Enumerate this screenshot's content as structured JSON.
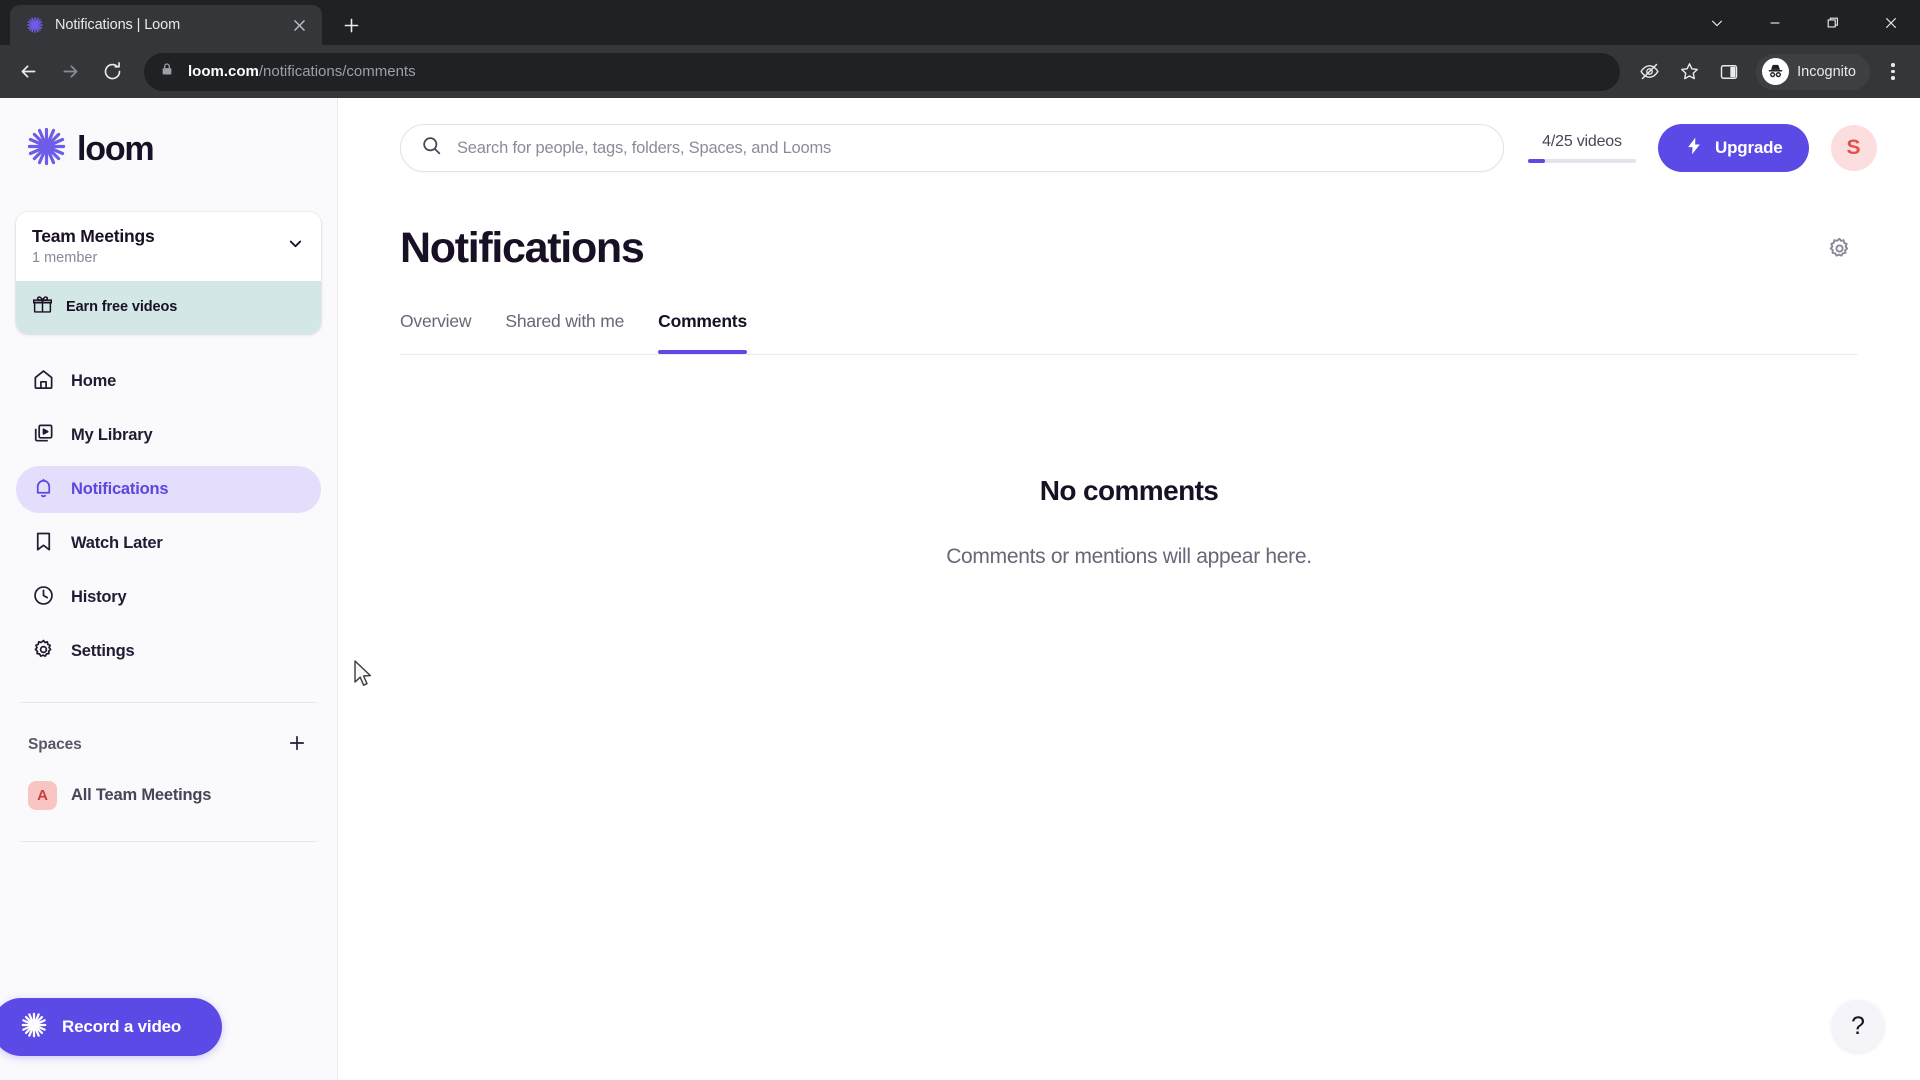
{
  "browser": {
    "tab": {
      "title": "Notifications | Loom",
      "favicon_icon": "loom-logo-icon",
      "close_icon": "close-icon"
    },
    "newtab_icon": "plus-icon",
    "window_controls": [
      {
        "name": "chevron-down-icon",
        "glyph": "chevron-down"
      },
      {
        "name": "minimize-icon",
        "glyph": "minimize"
      },
      {
        "name": "maximize-icon",
        "glyph": "maximize"
      },
      {
        "name": "close-window-icon",
        "glyph": "close"
      }
    ],
    "nav": {
      "back_icon": "back-arrow-icon",
      "forward_icon": "forward-arrow-icon",
      "reload_icon": "reload-icon"
    },
    "omnibox": {
      "lock_icon": "lock-icon",
      "host": "loom.com",
      "path": "/notifications/comments"
    },
    "toolbar_icons": [
      {
        "name": "eye-slash-icon"
      },
      {
        "name": "bookmark-star-icon"
      },
      {
        "name": "side-panel-icon"
      }
    ],
    "incognito": {
      "label": "Incognito",
      "icon": "incognito-icon"
    },
    "menu_icon": "three-dot-menu-icon"
  },
  "sidebar": {
    "brand": {
      "word": "loom",
      "icon": "loom-starburst-icon"
    },
    "workspace": {
      "name": "Team Meetings",
      "members": "1 member",
      "chevron_icon": "chevron-down-icon",
      "earn": {
        "label": "Earn free videos",
        "icon": "gift-icon"
      }
    },
    "nav_items": [
      {
        "label": "Home",
        "icon": "home-icon",
        "active": false
      },
      {
        "label": "My Library",
        "icon": "library-icon",
        "active": false
      },
      {
        "label": "Notifications",
        "icon": "bell-icon",
        "active": true
      },
      {
        "label": "Watch Later",
        "icon": "bookmark-icon",
        "active": false
      },
      {
        "label": "History",
        "icon": "clock-icon",
        "active": false
      },
      {
        "label": "Settings",
        "icon": "gear-icon",
        "active": false
      }
    ],
    "spaces": {
      "title": "Spaces",
      "add_icon": "plus-icon",
      "items": [
        {
          "label": "All Team Meetings",
          "initial": "A"
        }
      ]
    },
    "record_button": {
      "label": "Record a video",
      "icon": "loom-starburst-icon"
    }
  },
  "topbar": {
    "search": {
      "placeholder": "Search for people, tags, folders, Spaces, and Looms",
      "value": "",
      "icon": "search-icon"
    },
    "video_counter": {
      "text": "4/25 videos",
      "used": 4,
      "total": 25,
      "percent": 16
    },
    "upgrade": {
      "label": "Upgrade",
      "icon": "lightning-bolt-icon"
    },
    "avatar": {
      "initial": "S"
    }
  },
  "page": {
    "title": "Notifications",
    "settings_icon": "gear-icon",
    "tabs": [
      {
        "label": "Overview",
        "active": false
      },
      {
        "label": "Shared with me",
        "active": false
      },
      {
        "label": "Comments",
        "active": true
      }
    ],
    "empty_state": {
      "title": "No comments",
      "subtitle": "Comments or mentions will appear here."
    },
    "help_button": {
      "label": "?"
    }
  },
  "colors": {
    "brand_purple": "#5c4ae6",
    "active_nav_bg": "#e4defc",
    "earn_teal": "#d3e8e6",
    "space_avatar_bg": "#f9c5c3",
    "avatar_bg": "#fbdedd"
  }
}
